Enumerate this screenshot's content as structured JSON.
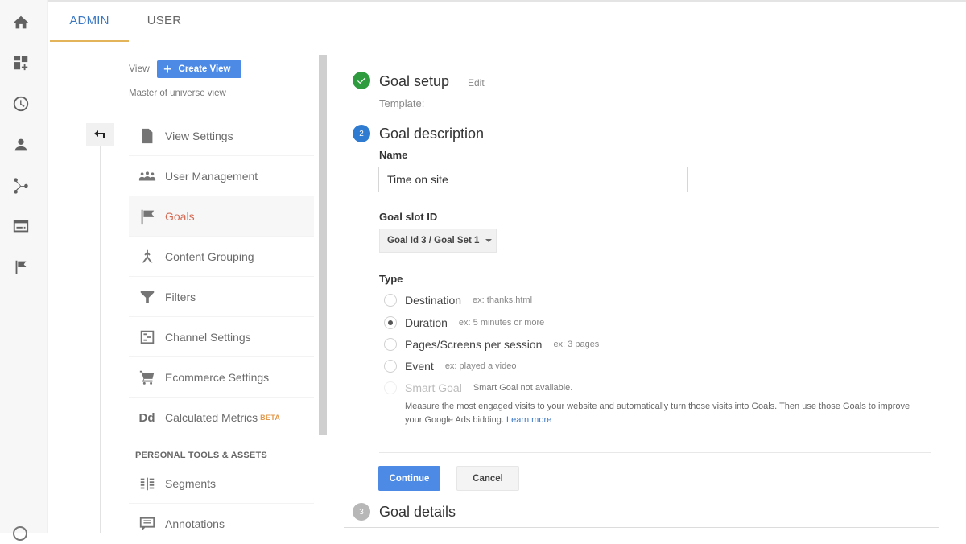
{
  "tabs": [
    {
      "label": "ADMIN",
      "active": true
    },
    {
      "label": "USER",
      "active": false
    }
  ],
  "rail": {
    "icons": [
      "home-icon",
      "customization-icon",
      "realtime-clock-icon",
      "audience-icon",
      "acquisition-icon",
      "behavior-icon",
      "conversions-flag-icon"
    ]
  },
  "view": {
    "label": "View",
    "create_button": "Create View",
    "current_view": "Master of universe view"
  },
  "menu": {
    "items": [
      {
        "label": "View Settings",
        "icon": "document-icon",
        "active": false
      },
      {
        "label": "User Management",
        "icon": "users-icon",
        "active": false
      },
      {
        "label": "Goals",
        "icon": "flag-icon",
        "active": true
      },
      {
        "label": "Content Grouping",
        "icon": "content-grouping-icon",
        "active": false
      },
      {
        "label": "Filters",
        "icon": "filter-icon",
        "active": false
      },
      {
        "label": "Channel Settings",
        "icon": "channel-settings-icon",
        "active": false
      },
      {
        "label": "Ecommerce Settings",
        "icon": "cart-icon",
        "active": false
      },
      {
        "label": "Calculated Metrics",
        "icon": "dd-icon",
        "badge": "BETA",
        "active": false
      }
    ],
    "section_heading": "PERSONAL TOOLS & ASSETS",
    "personal_items": [
      {
        "label": "Segments",
        "icon": "segments-icon"
      },
      {
        "label": "Annotations",
        "icon": "annotations-icon"
      }
    ],
    "dd_icon_text": "Dd"
  },
  "steps": {
    "step1": {
      "title": "Goal setup",
      "edit": "Edit",
      "template_label": "Template:",
      "status": "complete"
    },
    "step2": {
      "number": "2",
      "title": "Goal description"
    },
    "step3": {
      "number": "3",
      "title": "Goal details"
    }
  },
  "form": {
    "name_label": "Name",
    "name_value": "Time on site",
    "slot_label": "Goal slot ID",
    "slot_value": "Goal Id 3 / Goal Set 1",
    "type_label": "Type",
    "types": [
      {
        "label": "Destination",
        "hint": "ex: thanks.html",
        "checked": false,
        "disabled": false
      },
      {
        "label": "Duration",
        "hint": "ex: 5 minutes or more",
        "checked": true,
        "disabled": false
      },
      {
        "label": "Pages/Screens per session",
        "hint": "ex: 3 pages",
        "checked": false,
        "disabled": false
      },
      {
        "label": "Event",
        "hint": "ex: played a video",
        "checked": false,
        "disabled": false
      },
      {
        "label": "Smart Goal",
        "hint": "Smart Goal not available.",
        "checked": false,
        "disabled": true
      }
    ],
    "smart_goal_description": "Measure the most engaged visits to your website and automatically turn those visits into Goals. Then use those Goals to improve your Google Ads bidding.",
    "learn_more": "Learn more",
    "continue_label": "Continue",
    "cancel_label": "Cancel"
  },
  "colors": {
    "accent_blue": "#4c8ae6",
    "tab_active": "#3b78c4",
    "tab_underline": "#e3b45a",
    "active_menu_text": "#d46c55",
    "step_complete": "#2e9b3f",
    "step_current": "#2e7bd1",
    "step_pending": "#b7b7b7"
  }
}
